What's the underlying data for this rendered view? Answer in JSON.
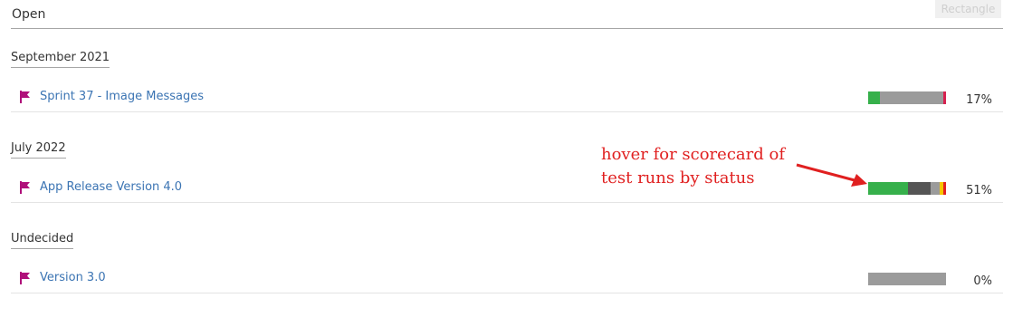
{
  "header": {
    "title": "Open",
    "shape_label": "Rectangle"
  },
  "groups": [
    {
      "heading": "September 2021",
      "rows": [
        {
          "name": "Sprint 37 - Image Messages",
          "percent_label": "17%",
          "segments": [
            {
              "color": "#36b04b",
              "fraction": 0.15
            },
            {
              "color": "#9b9b9b",
              "fraction": 0.82
            },
            {
              "color": "#d6204f",
              "fraction": 0.03
            }
          ]
        }
      ]
    },
    {
      "heading": "July 2022",
      "rows": [
        {
          "name": "App Release Version 4.0",
          "percent_label": "51%",
          "segments": [
            {
              "color": "#36b04b",
              "fraction": 0.51
            },
            {
              "color": "#555555",
              "fraction": 0.29
            },
            {
              "color": "#9b9b9b",
              "fraction": 0.12
            },
            {
              "color": "#f5c400",
              "fraction": 0.04
            },
            {
              "color": "#e32020",
              "fraction": 0.04
            }
          ]
        }
      ]
    },
    {
      "heading": "Undecided",
      "rows": [
        {
          "name": "Version 3.0",
          "percent_label": "0%",
          "segments": [
            {
              "color": "#9b9b9b",
              "fraction": 1.0
            }
          ]
        }
      ]
    }
  ],
  "annotation": {
    "line1": "hover for scorecard of",
    "line2": "test runs by status",
    "color": "#e02020"
  },
  "colors": {
    "flag": "#b0107a",
    "link": "#3b74b3"
  },
  "icons": {
    "row_icon": "flag-icon"
  }
}
